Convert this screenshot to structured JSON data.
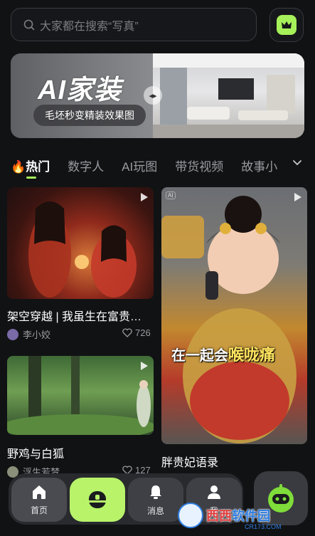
{
  "search": {
    "placeholder": "大家都在搜索“写真”"
  },
  "banner": {
    "title": "AI家装",
    "subtitle": "毛坯秒变精装效果图"
  },
  "tabs": [
    {
      "label": "🔥热门",
      "active": true
    },
    {
      "label": "数字人"
    },
    {
      "label": "AI玩图"
    },
    {
      "label": "带货视频"
    },
    {
      "label": "故事小"
    }
  ],
  "feed": {
    "card1": {
      "title": "架空穿越 | 我虽生在富贵…",
      "author": "李小姣",
      "likes": "726"
    },
    "card2": {
      "title": "胖贵妃语录",
      "ai_tag": "AI",
      "overlay_prefix": "在一起会",
      "overlay_highlight": "喉咙痛"
    },
    "card3": {
      "title": "野鸡与白狐",
      "author": "浮生若梦",
      "likes": "127"
    }
  },
  "nav": {
    "home": "首页",
    "messages": "消息",
    "me": "我"
  },
  "watermark": {
    "brand_a": "西西",
    "brand_b": "软件园",
    "url": "CR173.COM"
  },
  "colors": {
    "accent": "#a6f05a",
    "background": "#111214"
  }
}
